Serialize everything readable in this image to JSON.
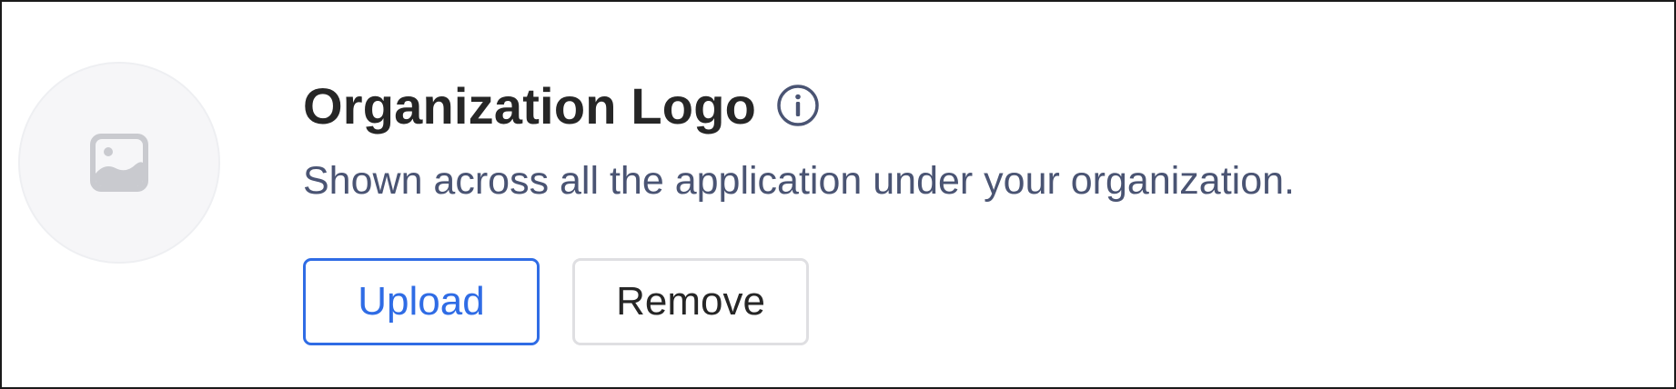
{
  "logo": {
    "icon": "image-icon",
    "background": "#f6f6f8"
  },
  "header": {
    "title": "Organization Logo",
    "info_icon": "info-icon"
  },
  "description": "Shown across all the application under your organization.",
  "actions": {
    "upload_label": "Upload",
    "remove_label": "Remove"
  },
  "colors": {
    "accent": "#2f6ce5",
    "title_text": "#262626",
    "muted_text": "#4a5473",
    "border_gray": "#dfdfe2"
  }
}
